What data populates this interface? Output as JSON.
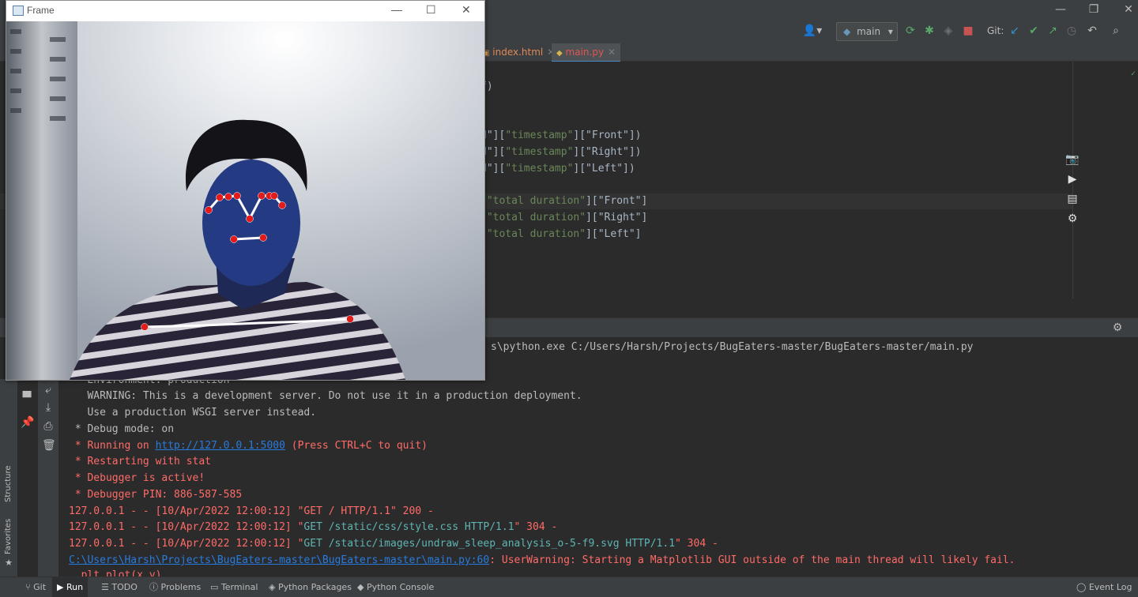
{
  "ide": {
    "branch": "main",
    "git_label": "Git:",
    "tabs": [
      {
        "label": "index.html",
        "icon": "html-file-icon"
      },
      {
        "label": "main.py",
        "icon": "python-file-icon"
      }
    ],
    "code_lines": [
      {
        "pre": "f)",
        "str": "",
        "post": ""
      },
      {
        "pre": "d\"][",
        "str": "\"timestamp\"",
        "post": "][\"Front\"])"
      },
      {
        "pre": "d\"][",
        "str": "\"timestamp\"",
        "post": "][\"Right\"])"
      },
      {
        "pre": "d\"][",
        "str": "\"timestamp\"",
        "post": "][\"Left\"])"
      },
      {
        "pre": "[",
        "str": "\"total duration\"",
        "post": "][\"Front\"]"
      },
      {
        "pre": "[",
        "str": "\"total duration\"",
        "post": "][\"Right\"]"
      },
      {
        "pre": "[",
        "str": "\"total duration\"",
        "post": "][\"Left\"]"
      },
      {
        "pre": ":",
        "str": "",
        "post": ""
      },
      {
        "pre": "\"",
        "str": "",
        "post": ""
      }
    ]
  },
  "console": {
    "command": "s\\python.exe C:/Users/Harsh/Projects/BugEaters-master/BugEaters-master/main.py",
    "lines": [
      {
        "text": " * Environment: production",
        "cls": "c-gray"
      },
      {
        "text": "   WARNING: This is a development server. Do not use it in a production deployment.",
        "cls": "c-gray"
      },
      {
        "text": "   Use a production WSGI server instead.",
        "cls": "c-gray"
      },
      {
        "text": " * Debug mode: on",
        "cls": "c-gray"
      }
    ],
    "running_prefix": " * Running on ",
    "running_link": "http://127.0.0.1:5000",
    "running_suffix": " (Press CTRL+C to quit)",
    "restart": " * Restarting with stat",
    "debugger_active": " * Debugger is active!",
    "debugger_pin": " * Debugger PIN: 886-587-585",
    "req1": "127.0.0.1 - - [10/Apr/2022 12:00:12] \"GET / HTTP/1.1\" 200 -",
    "req2_a": "127.0.0.1 - - [10/Apr/2022 12:00:12] \"",
    "req2_b": "GET /static/css/style.css HTTP/1.1",
    "req2_c": "\" 304 -",
    "req3_a": "127.0.0.1 - - [10/Apr/2022 12:00:12] \"",
    "req3_b": "GET /static/images/undraw_sleep_analysis_o-5-f9.svg HTTP/1.1",
    "req3_c": "\" 304 -",
    "warn_link": "C:\\Users\\Harsh\\Projects\\BugEaters-master\\BugEaters-master\\main.py:60",
    "warn_text": ": UserWarning: Starting a Matplotlib GUI outside of the main thread will likely fail.",
    "last_partial": "  plt.plot(x,y)"
  },
  "frame_window": {
    "title": "Frame"
  },
  "left_strip": {
    "structure": "Structure",
    "favorites": "Favorites"
  },
  "statusbar": {
    "items": [
      "Git",
      "Run",
      "TODO",
      "Problems",
      "Terminal",
      "Python Packages",
      "Python Console"
    ],
    "event_log": "Event Log"
  },
  "colors": {
    "accent": "#4a88c7",
    "error": "#ff6b68",
    "landmark": "#e51b1b"
  }
}
